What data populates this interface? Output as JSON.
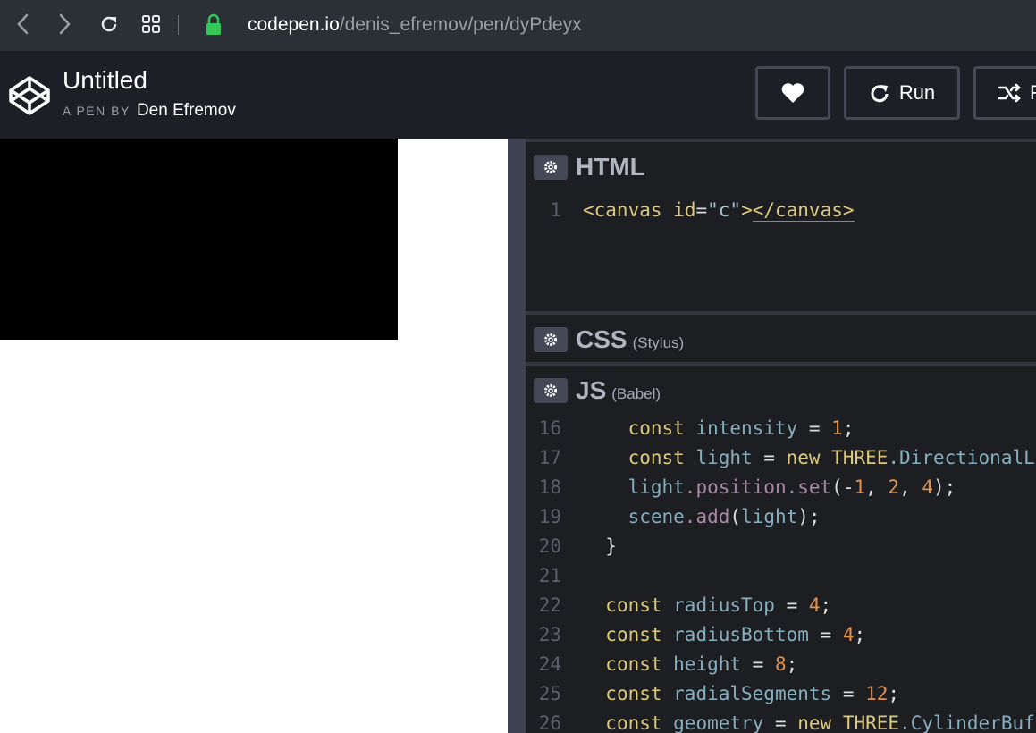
{
  "browser": {
    "url_domain": "codepen.io",
    "url_path": "/denis_efremov/pen/dyPdeyx"
  },
  "header": {
    "title": "Untitled",
    "by_label": "A PEN BY",
    "author": "Den Efremov",
    "run_label": "Run",
    "third_label": "F"
  },
  "editors": {
    "html": {
      "title": "HTML",
      "sub": ""
    },
    "css": {
      "title": "CSS",
      "sub": "(Stylus)"
    },
    "js": {
      "title": "JS",
      "sub": "(Babel)"
    }
  },
  "html_code": {
    "ln": "1",
    "tag_open": "<canvas",
    "attr": "id",
    "eq": "=",
    "val": "\"c\"",
    "tag_gt": ">",
    "tag_close": "</canvas>"
  },
  "js_code": [
    {
      "ln": "16",
      "indent": "    ",
      "t1": "const",
      "t2": " intensity",
      "t3": " = ",
      "t4": "1",
      "t5": ";"
    },
    {
      "ln": "17",
      "indent": "    ",
      "t1": "const",
      "t2": " light",
      "t3": " = ",
      "t4": "new",
      "t5": " THREE",
      "t6": ".DirectionalLi"
    },
    {
      "ln": "18",
      "indent": "    ",
      "t1": "light",
      "t2": ".position",
      "t3": ".set",
      "t4": "(-",
      "t5": "1",
      "t6": ", ",
      "t7": "2",
      "t8": ", ",
      "t9": "4",
      "t10": ");"
    },
    {
      "ln": "19",
      "indent": "    ",
      "t1": "scene",
      "t2": ".add",
      "t3": "(",
      "t4": "light",
      "t5": ");"
    },
    {
      "ln": "20",
      "indent": "  ",
      "t1": "}"
    },
    {
      "ln": "21",
      "indent": "",
      "t1": ""
    },
    {
      "ln": "22",
      "indent": "  ",
      "t1": "const",
      "t2": " radiusTop",
      "t3": " = ",
      "t4": "4",
      "t5": ";"
    },
    {
      "ln": "23",
      "indent": "  ",
      "t1": "const",
      "t2": " radiusBottom",
      "t3": " = ",
      "t4": "4",
      "t5": ";"
    },
    {
      "ln": "24",
      "indent": "  ",
      "t1": "const",
      "t2": " height",
      "t3": " = ",
      "t4": "8",
      "t5": ";"
    },
    {
      "ln": "25",
      "indent": "  ",
      "t1": "const",
      "t2": " radialSegments",
      "t3": " = ",
      "t4": "12",
      "t5": ";"
    },
    {
      "ln": "26",
      "indent": "  ",
      "t1": "const",
      "t2": " geometry",
      "t3": " = ",
      "t4": "new",
      "t5": " THREE",
      "t6": ".CylinderBuff"
    }
  ],
  "colors": {
    "browser_bar": "#2b3036",
    "header_bg": "#1e1f26",
    "editor_bg": "#1d1e22",
    "keyword": "#ddca7e",
    "identifier": "#88afbf",
    "number": "#e2924e",
    "lock_green": "#35c759"
  },
  "icons": {
    "back": "chevron-left-icon",
    "forward": "chevron-right-icon",
    "reload": "reload-icon",
    "tabs": "grid-icon",
    "lock": "lock-icon",
    "logo": "codepen-logo-icon",
    "heart": "heart-icon",
    "run": "run-icon",
    "fork": "fork-icon",
    "gear": "gear-icon"
  }
}
